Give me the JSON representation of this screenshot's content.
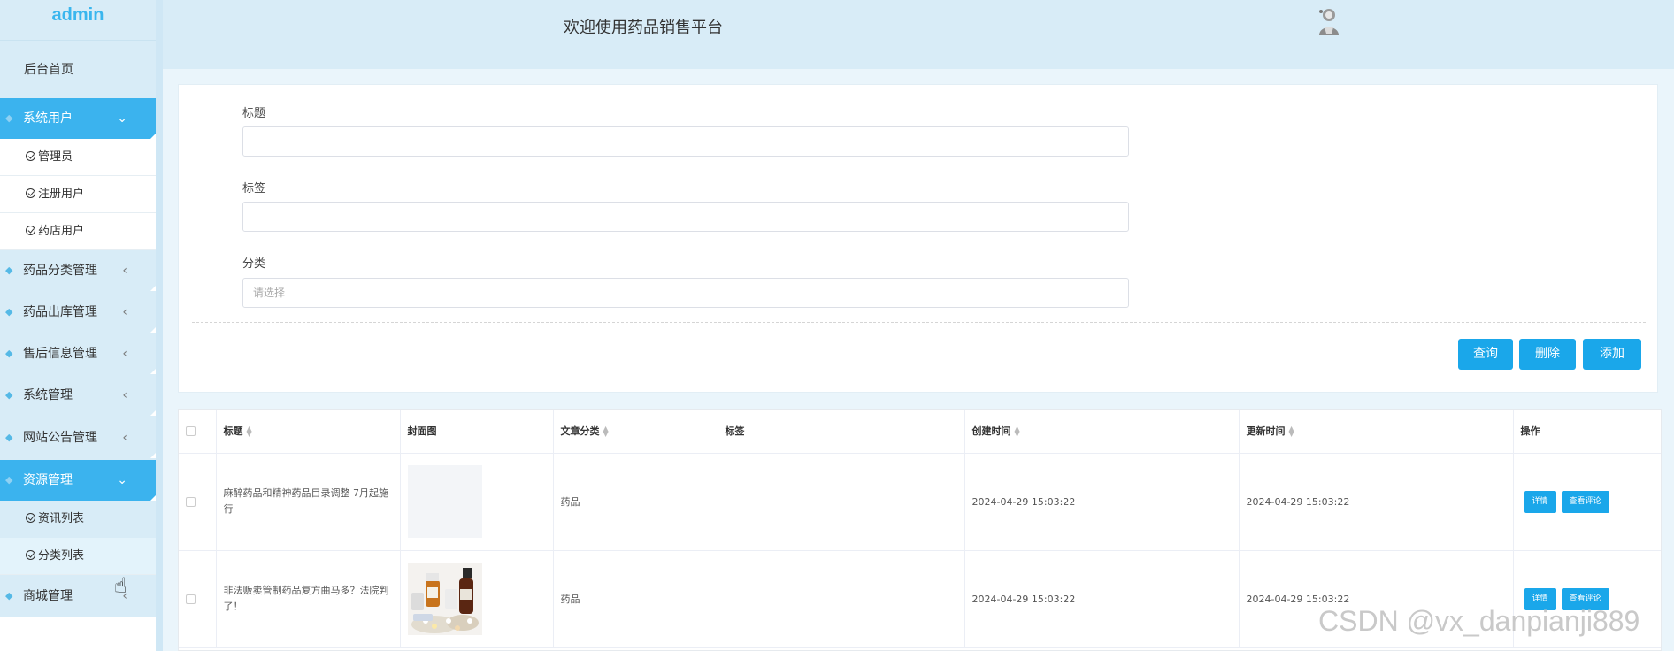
{
  "sidebar": {
    "brand": "admin",
    "home": "后台首页",
    "groups": [
      {
        "label": "系统用户",
        "expanded": true,
        "items": [
          "管理员",
          "注册用户",
          "药店用户"
        ]
      },
      {
        "label": "药品分类管理",
        "expanded": false
      },
      {
        "label": "药品出库管理",
        "expanded": false
      },
      {
        "label": "售后信息管理",
        "expanded": false
      },
      {
        "label": "系统管理",
        "expanded": false
      },
      {
        "label": "网站公告管理",
        "expanded": false
      },
      {
        "label": "资源管理",
        "expanded": true,
        "items": [
          "资讯列表",
          "分类列表"
        ]
      },
      {
        "label": "商城管理",
        "expanded": false
      }
    ]
  },
  "header": {
    "welcome": "欢迎使用药品销售平台"
  },
  "search": {
    "title_label": "标题",
    "title_value": "",
    "tag_label": "标签",
    "tag_value": "",
    "category_label": "分类",
    "category_placeholder": "请选择",
    "query_button": "查询",
    "delete_button": "删除",
    "add_button": "添加"
  },
  "table": {
    "columns": [
      "标题",
      "封面图",
      "文章分类",
      "标签",
      "创建时间",
      "更新时间",
      "操作"
    ],
    "rows": [
      {
        "title": "麻醉药品和精神药品目录调整 7月起施行",
        "category": "药品",
        "tag": "",
        "created": "2024-04-29 15:03:22",
        "updated": "2024-04-29 15:03:22",
        "detail": "详情",
        "comments": "查看评论"
      },
      {
        "title": "非法贩卖管制药品复方曲马多？法院判了！",
        "category": "药品",
        "tag": "",
        "created": "2024-04-29 15:03:22",
        "updated": "2024-04-29 15:03:22",
        "detail": "详情",
        "comments": "查看评论"
      }
    ]
  },
  "watermark": "CSDN @vx_danpianji889",
  "colors": {
    "accent": "#1aa7ea",
    "sidebar_bg": "#d8ecf7",
    "active_menu": "#3bb3ee"
  }
}
